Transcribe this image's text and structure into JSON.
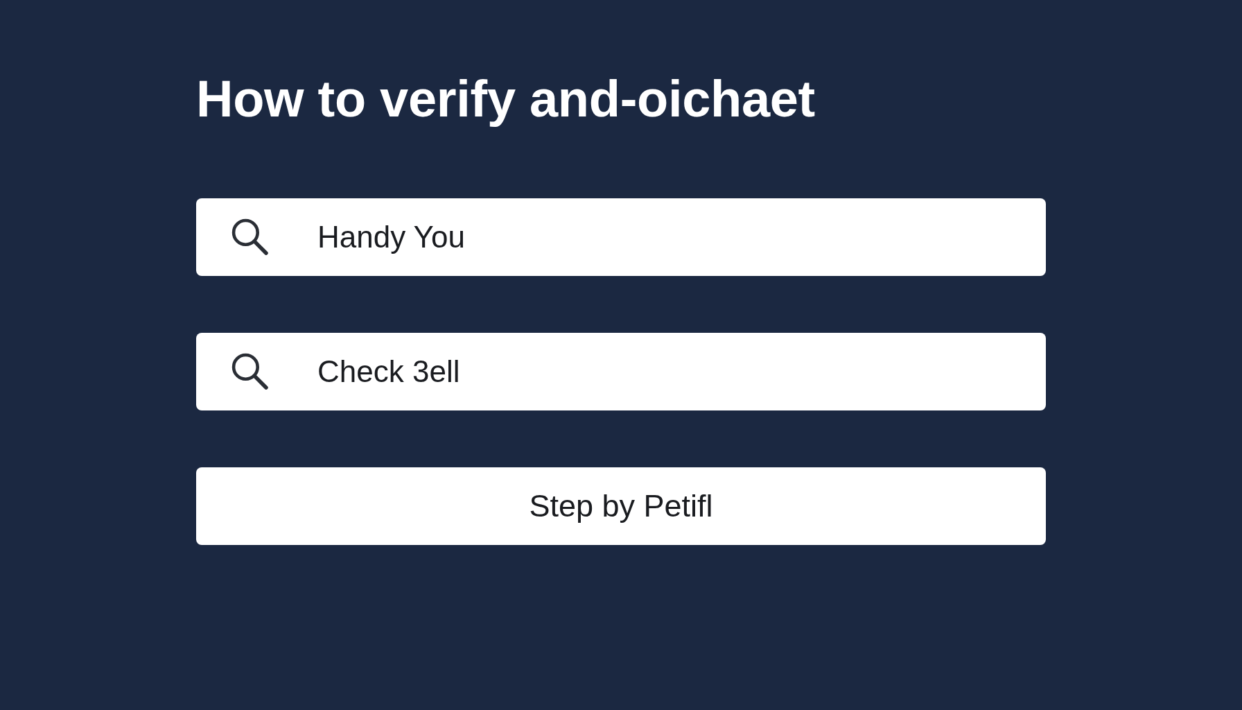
{
  "title": "How to verify and-oichaet",
  "search_fields": [
    {
      "value": "Handy You"
    },
    {
      "value": "Check 3ell"
    }
  ],
  "button": {
    "label": "Step by Petifl"
  }
}
